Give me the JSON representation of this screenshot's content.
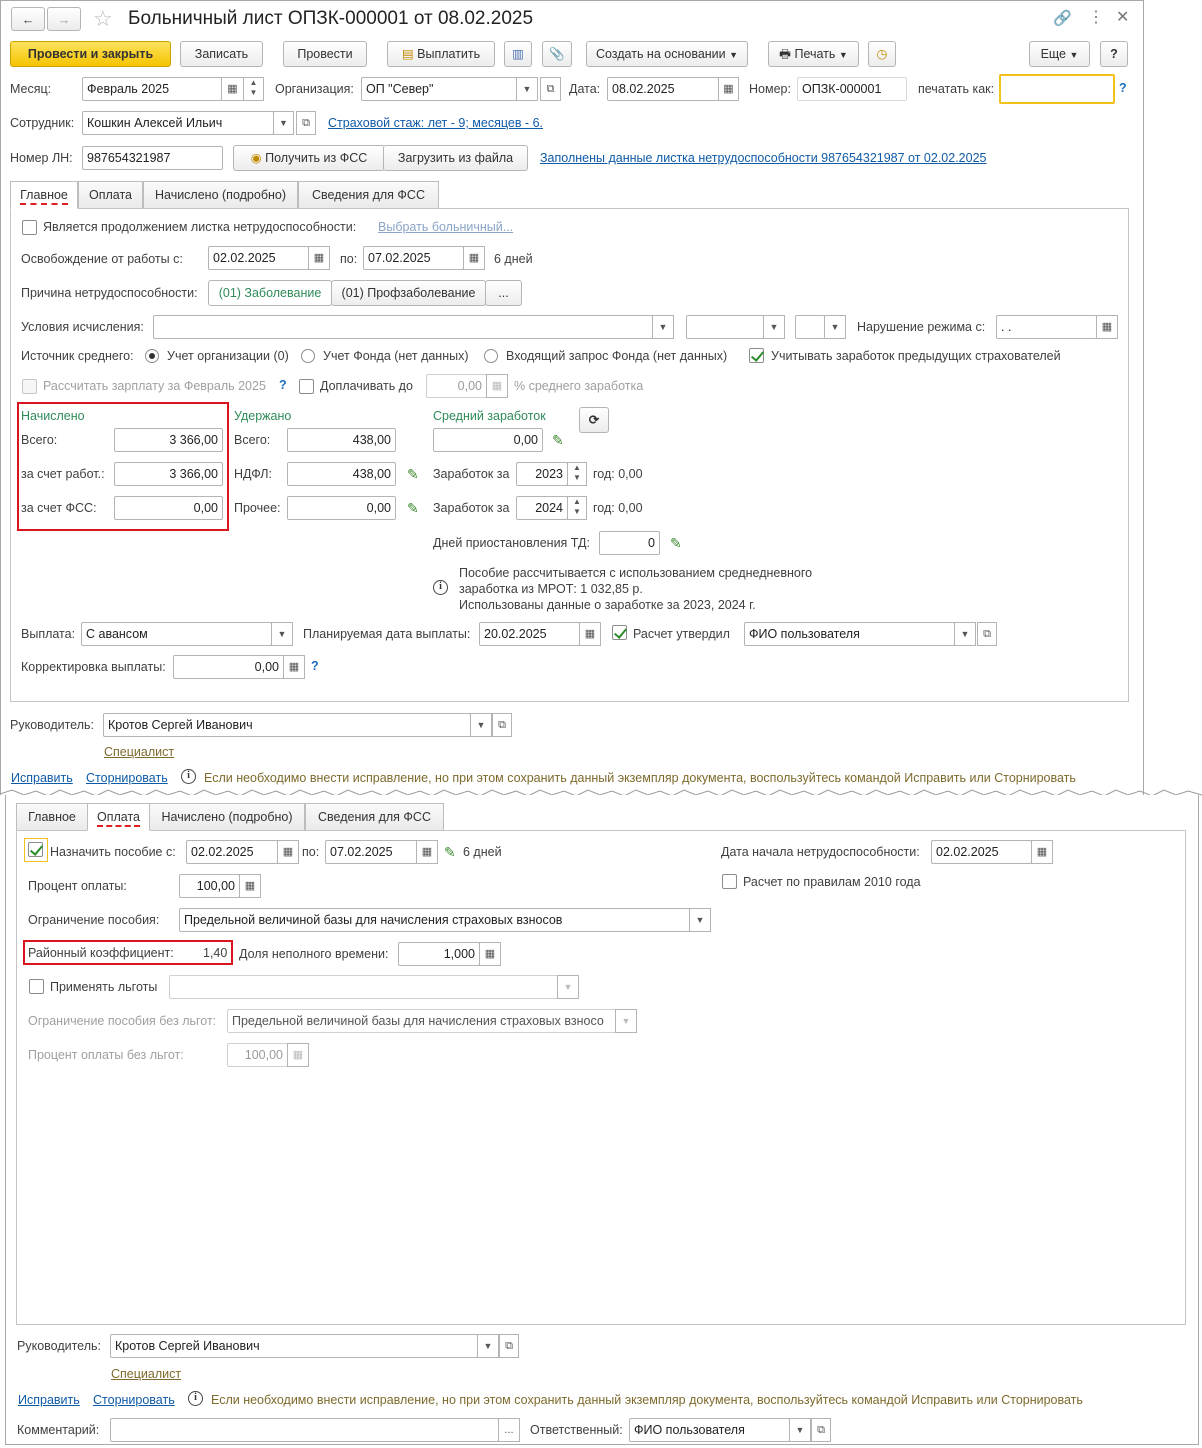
{
  "title": "Больничный лист ОПЗК-000001 от 08.02.2025",
  "toolbar": {
    "post_close": "Провести и закрыть",
    "save": "Записать",
    "post": "Провести",
    "pay": "Выплатить",
    "create_based": "Создать на основании",
    "print": "Печать",
    "more": "Еще",
    "help": "?"
  },
  "header": {
    "month_label": "Месяц:",
    "month": "Февраль 2025",
    "org_label": "Организация:",
    "org": "ОП \"Север\"",
    "date_label": "Дата:",
    "date": "08.02.2025",
    "number_label": "Номер:",
    "number": "ОПЗК-000001",
    "print_as_label": "печатать как:",
    "print_as": "",
    "employee_label": "Сотрудник:",
    "employee": "Кошкин Алексей Ильич",
    "insurance_link": "Страховой стаж: лет - 9; месяцев - 6.",
    "ln_label": "Номер ЛН:",
    "ln": "987654321987",
    "get_fss": "Получить из ФСС",
    "load_file": "Загрузить из файла",
    "filled_link": "Заполнены данные листка нетрудоспособности 987654321987 от 02.02.2025"
  },
  "tabs": [
    "Главное",
    "Оплата",
    "Начислено (подробно)",
    "Сведения для ФСС"
  ],
  "main": {
    "continuation": "Является продолжением листка нетрудоспособности:",
    "choose_sick": "Выбрать больничный...",
    "release_label": "Освобождение от работы с:",
    "release_from": "02.02.2025",
    "to_label": "по:",
    "release_to": "07.02.2025",
    "days": "6 дней",
    "cause_label": "Причина нетрудоспособности:",
    "cause1": "(01) Заболевание",
    "cause2": "(01) Профзаболевание",
    "cause_more": "...",
    "conditions_label": "Условия исчисления:",
    "conditions": "",
    "violation_label": "Нарушение режима с:",
    "violation": " .  .",
    "avg_source_label": "Источник среднего:",
    "src1": "Учет организации (0)",
    "src2": "Учет Фонда (нет данных)",
    "src3": "Входящий запрос Фонда (нет данных)",
    "prev_insurers": "Учитывать заработок предыдущих страхователей",
    "calc_salary": "Рассчитать зарплату за Февраль 2025",
    "calc_q": "?",
    "pay_extra": "Доплачивать до",
    "pay_extra_val": "0,00",
    "pct_avg": "% среднего заработка",
    "accrued_title": "Начислено",
    "total_label": "Всего:",
    "total": "3 366,00",
    "by_employer_label": "за счет работ.:",
    "by_employer": "3 366,00",
    "by_fss_label": "за счет ФСС:",
    "by_fss": "0,00",
    "withheld_title": "Удержано",
    "w_total_label": "Всего:",
    "w_total": "438,00",
    "ndfl_label": "НДФЛ:",
    "ndfl": "438,00",
    "other_label": "Прочее:",
    "other": "0,00",
    "avg_title": "Средний заработок",
    "avg": "0,00",
    "earn_label": "Заработок за",
    "y1": "2023",
    "y1_val": "год: 0,00",
    "y2": "2024",
    "y2_val": "год: 0,00",
    "suspend_label": "Дней приостановления ТД:",
    "suspend": "0",
    "note1": "Пособие рассчитывается с использованием среднедневного",
    "note2": "заработка из МРОТ: 1 032,85 р.",
    "note3": "Использованы данные о заработке за  2023,  2024 г.",
    "payout_label": "Выплата:",
    "payout": "С авансом",
    "plan_date_label": "Планируемая дата выплаты:",
    "plan_date": "20.02.2025",
    "approved_label": "Расчет утвердил",
    "approver": "ФИО пользователя",
    "correction_label": "Корректировка выплаты:",
    "correction": "0,00",
    "corr_q": "?"
  },
  "footer": {
    "manager_label": "Руководитель:",
    "manager": "Кротов Сергей Иванович",
    "specialist": "Специалист",
    "fix": "Исправить",
    "storno": "Сторнировать",
    "hint": "Если необходимо внести исправление, но при этом сохранить данный экземпляр документа, воспользуйтесь командой Исправить или Сторнировать",
    "comment_label": "Комментарий:",
    "comment": "",
    "responsible_label": "Ответственный:",
    "responsible": "ФИО пользователя"
  },
  "payment": {
    "assign_label": "Назначить пособие с:",
    "from": "02.02.2025",
    "to_label": "по:",
    "to": "07.02.2025",
    "days": "6 дней",
    "start_label": "Дата начала нетрудоспособности:",
    "start": "02.02.2025",
    "rules2010": "Расчет по правилам 2010 года",
    "pct_label": "Процент оплаты:",
    "pct": "100,00",
    "limit_label": "Ограничение пособия:",
    "limit": "Предельной величиной базы для начисления страховых взносов",
    "coef_label": "Районный коэффициент:",
    "coef": "1,40",
    "part_label": "Доля неполного времени:",
    "part": "1,000",
    "benefits_label": "Применять льготы",
    "benefits": "",
    "limit_nb_label": "Ограничение пособия без льгот:",
    "limit_nb": "Предельной величиной базы для начисления страховых взносо",
    "pct_nb_label": "Процент оплаты без льгот:",
    "pct_nb": "100,00"
  }
}
